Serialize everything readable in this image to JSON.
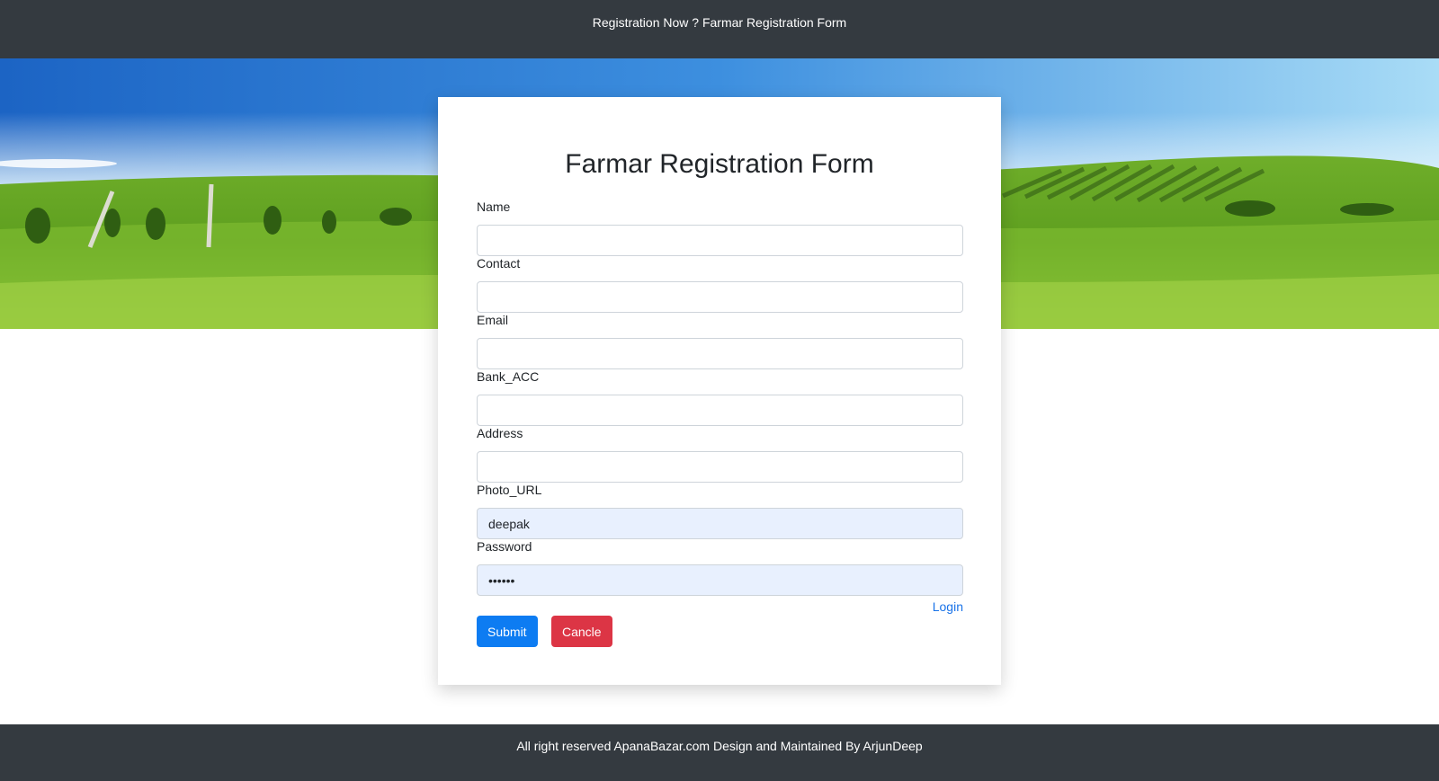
{
  "header": {
    "title": "Registration Now ? Farmar Registration Form"
  },
  "form": {
    "title": "Farmar Registration Form",
    "fields": [
      {
        "label": "Name",
        "value": ""
      },
      {
        "label": "Contact",
        "value": ""
      },
      {
        "label": "Email",
        "value": ""
      },
      {
        "label": "Bank_ACC",
        "value": ""
      },
      {
        "label": "Address",
        "value": ""
      },
      {
        "label": "Photo_URL",
        "value": "deepak"
      },
      {
        "label": "Password",
        "value": "••••••"
      }
    ],
    "login_link": "Login",
    "submit_label": "Submit",
    "cancel_label": "Cancle"
  },
  "footer": {
    "text": "All right reserved ApanaBazar.com Design and Maintained By ArjunDeep"
  },
  "colors": {
    "bar_background": "#343a40",
    "primary": "#0d7cf2",
    "danger": "#dc3545",
    "link": "#1a73e8",
    "autofill": "#e8f0fe"
  }
}
